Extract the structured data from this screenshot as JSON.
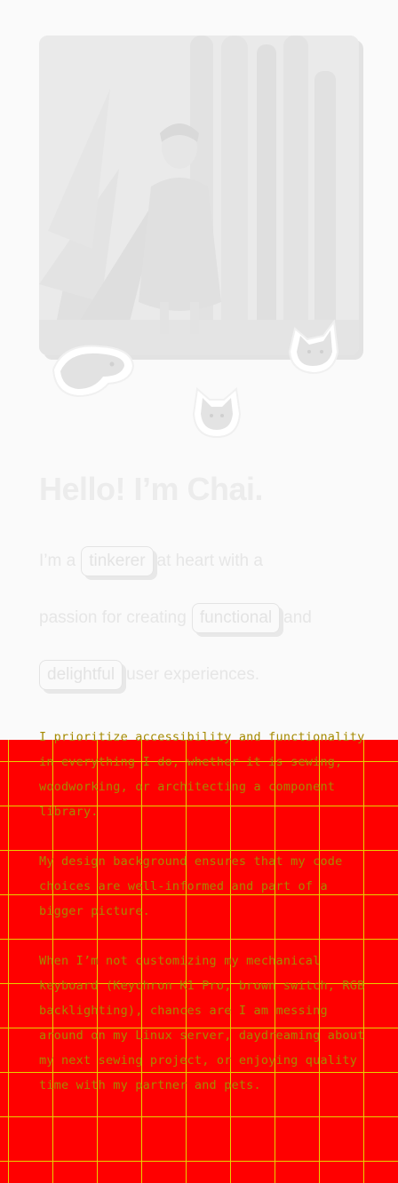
{
  "hero": {
    "headline": "Hello! I’m Chai."
  },
  "intro": {
    "part1": "I’m a",
    "chip1": "tinkerer",
    "part2": "at heart with a",
    "part3": "passion for creating",
    "chip2": "functional",
    "part4": "and",
    "chip3": "delightful",
    "part5": "user experiences."
  },
  "paragraphs": [
    "I prioritize accessibility and functionality in everything I do, whether it is sewing, woodworking, or architecting a component library.",
    "My design background ensures that my code choices are well-informed and part of a bigger picture.",
    "When I’m not customizing my mechanical keyboard (Keychron K1 Pro, brown switch, RGB backlighting), chances are I am messing around on my Linux server, daydreaming about my next sewing project, or enjoying quality time with my partner and pets."
  ],
  "colors": {
    "panel": "#ff0000",
    "grid": "#e6d100",
    "text_on_panel": "#a58a00",
    "faded_text": "#ececec"
  }
}
